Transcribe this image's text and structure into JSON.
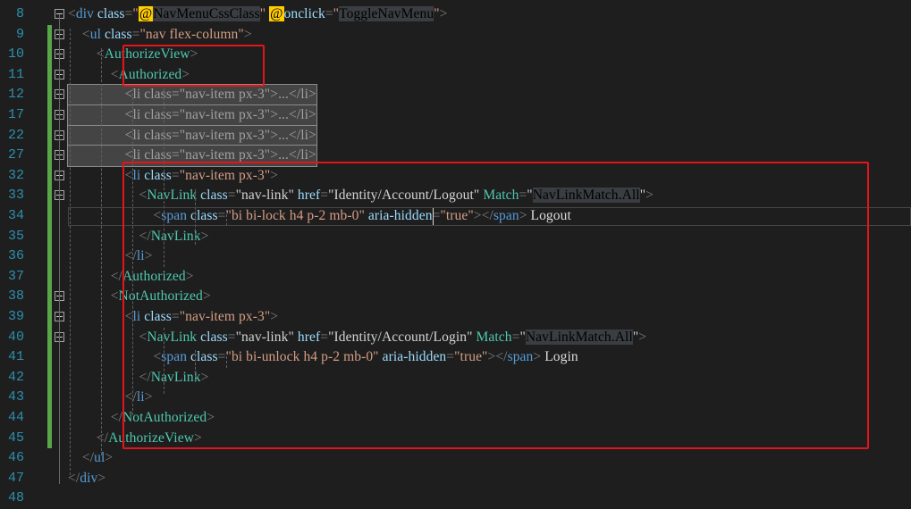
{
  "editor": {
    "lines": [
      {
        "num": "8",
        "tokens": [
          [
            "<",
            "t"
          ],
          [
            "div",
            "n"
          ],
          [
            " class",
            "a"
          ],
          [
            "=",
            "t"
          ],
          [
            "\"",
            "s"
          ],
          [
            "@",
            "rz"
          ],
          [
            "NavMenuCssClass",
            "hl"
          ],
          [
            "\"",
            "s"
          ],
          [
            " ",
            "p"
          ],
          [
            "@",
            "rz"
          ],
          [
            "onclick",
            "a"
          ],
          [
            "=",
            "t"
          ],
          [
            "\"",
            "s"
          ],
          [
            "ToggleNavMenu",
            "hl"
          ],
          [
            "\"",
            "s"
          ],
          [
            ">",
            "t"
          ]
        ]
      },
      {
        "num": "9",
        "tokens": [
          [
            "    <",
            "t"
          ],
          [
            "ul",
            "n"
          ],
          [
            " class",
            "a"
          ],
          [
            "=",
            "t"
          ],
          [
            "\"nav flex-column\"",
            "s"
          ],
          [
            ">",
            "t"
          ]
        ]
      },
      {
        "num": "10",
        "tokens": [
          [
            "        <",
            "t"
          ],
          [
            "AuthorizeView",
            "c"
          ],
          [
            ">",
            "t"
          ]
        ]
      },
      {
        "num": "11",
        "tokens": [
          [
            "            <",
            "t"
          ],
          [
            "Authorized",
            "c"
          ],
          [
            ">",
            "t"
          ]
        ]
      },
      {
        "num": "12",
        "collapsed": true,
        "tokens": [
          [
            "                <li class=\"nav-item px-3\">...</li>",
            "p"
          ]
        ]
      },
      {
        "num": "17",
        "collapsed": true,
        "tokens": [
          [
            "                <li class=\"nav-item px-3\">...</li>",
            "p"
          ]
        ]
      },
      {
        "num": "22",
        "collapsed": true,
        "tokens": [
          [
            "                <li class=\"nav-item px-3\">...</li>",
            "p"
          ]
        ]
      },
      {
        "num": "27",
        "collapsed": true,
        "tokens": [
          [
            "                <li class=\"nav-item px-3\">...</li>",
            "p"
          ]
        ]
      },
      {
        "num": "32",
        "tokens": [
          [
            "                <",
            "t"
          ],
          [
            "li",
            "n"
          ],
          [
            " class",
            "a"
          ],
          [
            "=",
            "t"
          ],
          [
            "\"nav-item px-3\"",
            "s"
          ],
          [
            ">",
            "t"
          ]
        ]
      },
      {
        "num": "33",
        "tokens": [
          [
            "                    <",
            "t"
          ],
          [
            "NavLink",
            "c"
          ],
          [
            " class",
            "a"
          ],
          [
            "=",
            "t"
          ],
          [
            "\"nav-link\"",
            "s2"
          ],
          [
            " href",
            "a"
          ],
          [
            "=",
            "t"
          ],
          [
            "\"Identity/Account/Logout\"",
            "s2"
          ],
          [
            " Match",
            "ca"
          ],
          [
            "=",
            "t"
          ],
          [
            "\"",
            "s2"
          ],
          [
            "NavLinkMatch.All",
            "hl"
          ],
          [
            "\"",
            "s2"
          ],
          [
            ">",
            "t"
          ]
        ]
      },
      {
        "num": "34",
        "tokens": [
          [
            "                        <",
            "t"
          ],
          [
            "span",
            "n"
          ],
          [
            " class",
            "a"
          ],
          [
            "=",
            "t"
          ],
          [
            "\"bi bi-lock h4 p-2 mb-0\"",
            "s"
          ],
          [
            " aria-hidden",
            "a"
          ],
          [
            "=",
            "t"
          ],
          [
            "\"true\"",
            "s"
          ],
          [
            "></",
            "t"
          ],
          [
            "span",
            "n"
          ],
          [
            ">",
            "t"
          ],
          [
            " Logout",
            "p"
          ]
        ]
      },
      {
        "num": "35",
        "tokens": [
          [
            "                    </",
            "t"
          ],
          [
            "NavLink",
            "c"
          ],
          [
            ">",
            "t"
          ]
        ]
      },
      {
        "num": "36",
        "tokens": [
          [
            "                </",
            "t"
          ],
          [
            "li",
            "n"
          ],
          [
            ">",
            "t"
          ]
        ]
      },
      {
        "num": "37",
        "tokens": [
          [
            "            </",
            "t"
          ],
          [
            "Authorized",
            "c"
          ],
          [
            ">",
            "t"
          ]
        ]
      },
      {
        "num": "38",
        "tokens": [
          [
            "            <",
            "t"
          ],
          [
            "NotAuthorized",
            "c"
          ],
          [
            ">",
            "t"
          ]
        ]
      },
      {
        "num": "39",
        "tokens": [
          [
            "                <",
            "t"
          ],
          [
            "li",
            "n"
          ],
          [
            " class",
            "a"
          ],
          [
            "=",
            "t"
          ],
          [
            "\"nav-item px-3\"",
            "s"
          ],
          [
            ">",
            "t"
          ]
        ]
      },
      {
        "num": "40",
        "tokens": [
          [
            "                    <",
            "t"
          ],
          [
            "NavLink",
            "c"
          ],
          [
            " class",
            "a"
          ],
          [
            "=",
            "t"
          ],
          [
            "\"nav-link\"",
            "s2"
          ],
          [
            " href",
            "a"
          ],
          [
            "=",
            "t"
          ],
          [
            "\"Identity/Account/Login\"",
            "s2"
          ],
          [
            " Match",
            "ca"
          ],
          [
            "=",
            "t"
          ],
          [
            "\"",
            "s2"
          ],
          [
            "NavLinkMatch.All",
            "hl"
          ],
          [
            "\"",
            "s2"
          ],
          [
            ">",
            "t"
          ]
        ]
      },
      {
        "num": "41",
        "tokens": [
          [
            "                        <",
            "t"
          ],
          [
            "span",
            "n"
          ],
          [
            " class",
            "a"
          ],
          [
            "=",
            "t"
          ],
          [
            "\"bi bi-unlock h4 p-2 mb-0\"",
            "s"
          ],
          [
            " aria-hidden",
            "a"
          ],
          [
            "=",
            "t"
          ],
          [
            "\"true\"",
            "s"
          ],
          [
            "></",
            "t"
          ],
          [
            "span",
            "n"
          ],
          [
            ">",
            "t"
          ],
          [
            " Login",
            "p"
          ]
        ]
      },
      {
        "num": "42",
        "tokens": [
          [
            "                    </",
            "t"
          ],
          [
            "NavLink",
            "c"
          ],
          [
            ">",
            "t"
          ]
        ]
      },
      {
        "num": "43",
        "tokens": [
          [
            "                </",
            "t"
          ],
          [
            "li",
            "n"
          ],
          [
            ">",
            "t"
          ]
        ]
      },
      {
        "num": "44",
        "tokens": [
          [
            "            </",
            "t"
          ],
          [
            "NotAuthorized",
            "c"
          ],
          [
            ">",
            "t"
          ]
        ]
      },
      {
        "num": "45",
        "tokens": [
          [
            "        </",
            "t"
          ],
          [
            "AuthorizeView",
            "c"
          ],
          [
            ">",
            "t"
          ]
        ]
      },
      {
        "num": "46",
        "tokens": [
          [
            "    </",
            "t"
          ],
          [
            "ul",
            "n"
          ],
          [
            ">",
            "t"
          ]
        ]
      },
      {
        "num": "47",
        "tokens": [
          [
            "</",
            "t"
          ],
          [
            "div",
            "n"
          ],
          [
            ">",
            "t"
          ]
        ]
      },
      {
        "num": "48",
        "tokens": []
      }
    ]
  },
  "colors": {
    "background": "#1e1e1e",
    "line_number": "#2b91af",
    "change_bar": "#57a64a",
    "annotation_box": "#e3141b"
  }
}
